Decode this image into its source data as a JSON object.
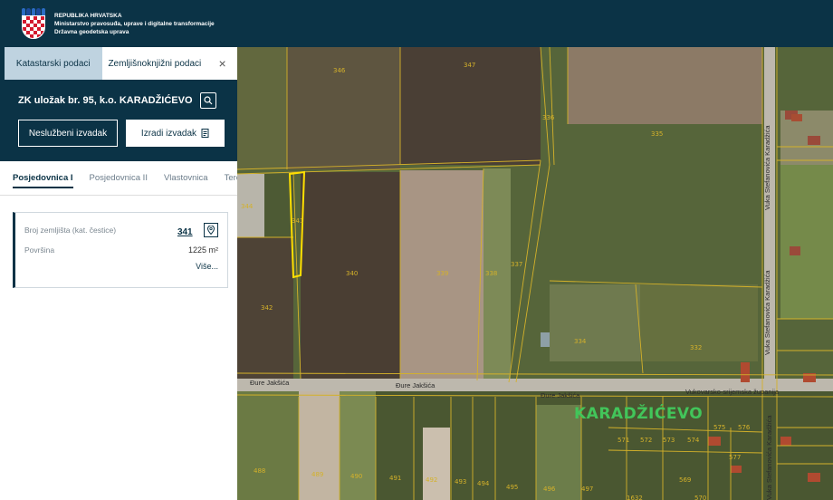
{
  "header": {
    "line1": "REPUBLIKA HRVATSKA",
    "line2": "Ministarstvo pravosuđa, uprave i digitalne transformacije",
    "line3": "Državna geodetska uprava"
  },
  "tabs": {
    "cadastral": "Katastarski podaci",
    "land_registry": "Zemljišnoknjižni podaci",
    "close": "×"
  },
  "panel": {
    "title": "ZK uložak br. 95, k.o. KARADŽIĆEVO",
    "unofficial_btn": "Neslužbeni izvadak",
    "make_btn": "Izradi izvadak"
  },
  "subtabs": [
    "Posjedovnica I",
    "Posjedovnica II",
    "Vlastovnica",
    "Teretovnica"
  ],
  "card": {
    "parcel_label": "Broj zemljišta (kat. čestice)",
    "parcel_value": "341",
    "area_label": "Površina",
    "area_value": "1225 m²",
    "more": "Više..."
  },
  "map": {
    "town": "KARADŽIĆEVO",
    "streets": [
      "Đure Jakšića",
      "Đure Jakšića",
      "Đure Jakšića",
      "Vukovarsko-srijemska županija",
      "Vuka Stefanovića Karadžića",
      "Vuka Stefanovića Karadžića",
      "Vuka Stefanovića Karadžića"
    ],
    "parcels": [
      "346",
      "347",
      "336",
      "335",
      "344",
      "341",
      "340",
      "339",
      "338",
      "337",
      "342",
      "334",
      "332",
      "488",
      "489",
      "490",
      "491",
      "492",
      "493",
      "494",
      "495",
      "496",
      "497",
      "571",
      "572",
      "573",
      "574",
      "575",
      "576",
      "577",
      "569",
      "570",
      "1632"
    ]
  },
  "colors": {
    "brand": "#0b3346",
    "accent": "#bfd3e0",
    "parcel_line": "#d4b12a",
    "selected_parcel": "#ffe000"
  }
}
